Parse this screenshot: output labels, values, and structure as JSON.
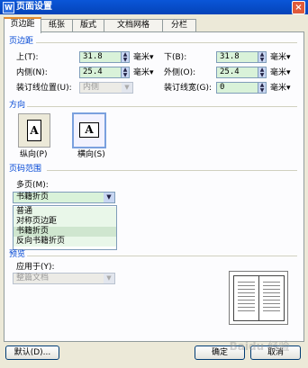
{
  "window": {
    "title": "页面设置",
    "app_icon_glyph": "W",
    "close_glyph": "×"
  },
  "tabs": [
    {
      "label": "页边距",
      "active": true
    },
    {
      "label": "纸张",
      "active": false
    },
    {
      "label": "版式",
      "active": false
    },
    {
      "label": "文档网格",
      "active": false
    },
    {
      "label": "分栏",
      "active": false
    }
  ],
  "margins": {
    "title": "页边距",
    "top": {
      "label": "上(T):",
      "value": "31.8",
      "unit": "毫米▾"
    },
    "bottom": {
      "label": "下(B):",
      "value": "31.8",
      "unit": "毫米▾"
    },
    "inside": {
      "label": "内侧(N):",
      "value": "25.4",
      "unit": "毫米▾"
    },
    "outside": {
      "label": "外侧(O):",
      "value": "25.4",
      "unit": "毫米▾"
    },
    "gutter_position": {
      "label": "装订线位置(U):",
      "value": "内侧"
    },
    "gutter_width": {
      "label": "装订线宽(G):",
      "value": "0",
      "unit": "毫米▾"
    }
  },
  "orientation": {
    "title": "方向",
    "portrait": {
      "label": "纵向(P)",
      "glyph": "A"
    },
    "landscape": {
      "label": "横向(S)",
      "glyph": "A"
    }
  },
  "page_range": {
    "title": "页码范围",
    "multiple_pages_label": "多页(M):",
    "multiple_pages_value": "书籍折页",
    "options": [
      "普通",
      "对称页边距",
      "书籍折页",
      "反向书籍折页"
    ],
    "highlighted_option": "书籍折页"
  },
  "preview": {
    "title": "预览",
    "apply_to_label": "应用于(Y):",
    "apply_to_value": "整篇文档"
  },
  "buttons": {
    "default": "默认(D)...",
    "ok": "确定",
    "cancel": "取消"
  },
  "watermark_text": "Baidu 经验",
  "colors": {
    "titlebar": "#0a56d8",
    "group_title": "#0046d5",
    "tab_accent": "#e68b2c",
    "spin_field": "#d9f2d9"
  },
  "icons": {
    "spin": "up-down-arrows-icon",
    "dropdown": "chevron-down-icon"
  }
}
